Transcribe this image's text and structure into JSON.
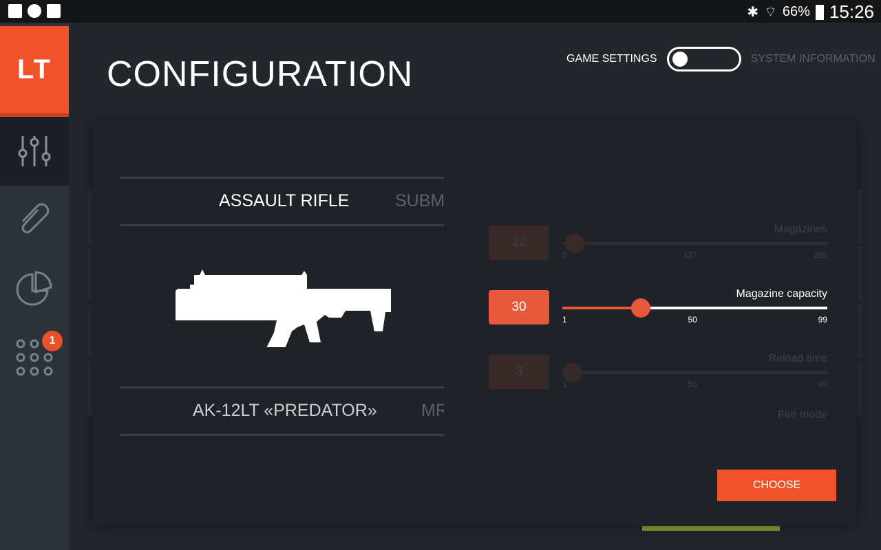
{
  "status_bar": {
    "battery": "66%",
    "time": "15:26",
    "icons": [
      "image-icon",
      "cloud-upload-icon",
      "clipboard-check-icon"
    ],
    "right_icons": [
      "bluetooth-icon",
      "wifi-icon",
      "battery-icon"
    ]
  },
  "sidebar": {
    "logo": "LT",
    "items": [
      {
        "icon": "sliders-icon",
        "active": true
      },
      {
        "icon": "paperclip-icon"
      },
      {
        "icon": "pie-chart-icon"
      },
      {
        "icon": "apps-grid-icon",
        "badge": "1"
      }
    ]
  },
  "header": {
    "title": "CONFIGURATION",
    "toggle_left": "GAME SETTINGS",
    "toggle_right": "SYSTEM INFORMATION",
    "toggle_state": "game-settings"
  },
  "weapon": {
    "category": "ASSAULT RIFLE",
    "next_category": "SUBM",
    "model": "AK-12LT «PREDATOR»",
    "next_model": "MR"
  },
  "settings": [
    {
      "label": "Magazines",
      "value": 12,
      "min": 0,
      "mid": 127,
      "max": 255,
      "min_label": "0",
      "mid_label": "127",
      "max_label": "255",
      "value_label": "12"
    },
    {
      "label": "Magazine capacity",
      "value": 30,
      "min": 1,
      "mid": 50,
      "max": 99,
      "min_label": "1",
      "mid_label": "50",
      "max_label": "99",
      "value_label": "30"
    },
    {
      "label": "Reload time",
      "value": 3,
      "min": 1,
      "mid": 50,
      "max": 99,
      "min_label": "1",
      "mid_label": "50",
      "max_label": "99",
      "value_label": "3"
    },
    {
      "label": "Fire mode"
    }
  ],
  "choose_label": "CHOOSE",
  "colors": {
    "accent": "#f0522a",
    "background": "#23272c",
    "panel": "#1f2328"
  }
}
